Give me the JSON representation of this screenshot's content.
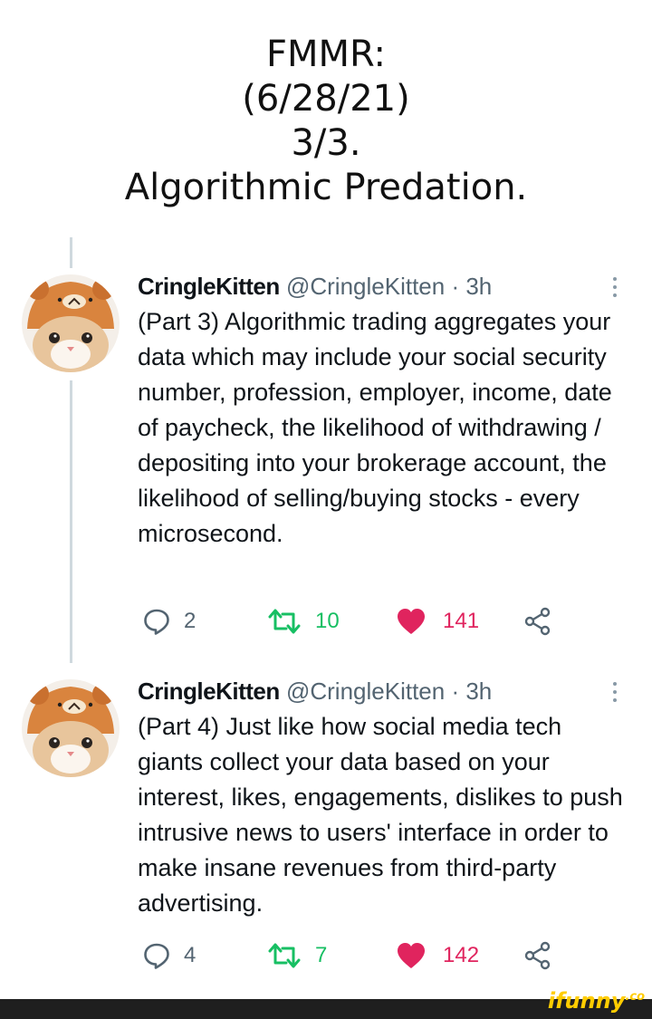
{
  "header": {
    "title_lines": [
      "FMMR:",
      "(6/28/21)",
      "3/3.",
      "Algorithmic Predation."
    ]
  },
  "tweets": [
    {
      "display_name": "CringleKitten",
      "handle_time": "@CringleKitten · 3h",
      "text": "(Part 3) Algorithmic trading aggregates your data which may include your social security number, profession, employer, income, date of paycheck, the likelihood of withdrawing / depositing into your brokerage account, the likelihood of selling/buying stocks - every microsecond.",
      "replies": "2",
      "retweets": "10",
      "likes": "141"
    },
    {
      "display_name": "CringleKitten",
      "handle_time": "@CringleKitten · 3h",
      "text": "(Part 4) Just like how social media tech giants collect your data based on your interest, likes, engagements, dislikes to push intrusive news to users' interface in order to make insane revenues from third-party advertising.",
      "replies": "4",
      "retweets": "7",
      "likes": "142"
    }
  ],
  "watermark": {
    "brand": "ifunny",
    "suffix": ".co"
  },
  "colors": {
    "like": "#e0245e",
    "retweet": "#17bf63",
    "icon_gray": "#536471",
    "thread_line": "#cfd9de"
  }
}
